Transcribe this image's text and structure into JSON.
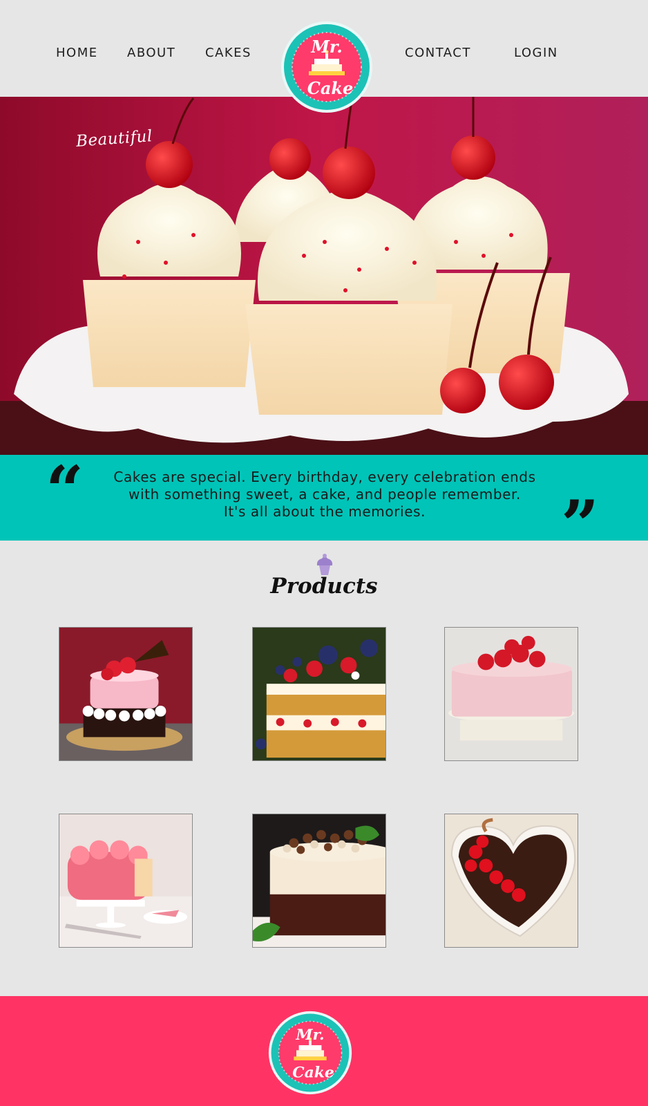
{
  "nav": {
    "home": "HOME",
    "about": "ABOUT",
    "cakes": "CAKES",
    "contact": "CONTACT",
    "login": "LOGIN"
  },
  "logo": {
    "line1": "Mr.",
    "line2": "Cake"
  },
  "hero": {
    "tagline": "Beautiful"
  },
  "quote": {
    "open_mark": "“",
    "close_mark": "”",
    "line1": "Cakes are special. Every birthday, every celebration ends",
    "line2": "with something sweet, a cake, and people remember.",
    "line3": "It's all about the memories."
  },
  "products": {
    "title": "Products",
    "icon": "cupcake-icon",
    "items": [
      {
        "image": "strawberry-layer-cake-photo"
      },
      {
        "image": "berry-sponge-cake-photo"
      },
      {
        "image": "strawberry-cream-cake-photo"
      },
      {
        "image": "pink-rose-cake-photo"
      },
      {
        "image": "chocolate-mousse-cake-photo"
      },
      {
        "image": "heart-chocolate-cake-photo"
      }
    ]
  },
  "colors": {
    "background": "#e6e6e6",
    "teal": "#00c4b8",
    "pink": "#ff3464",
    "hero_backdrop": "#b0124a"
  }
}
